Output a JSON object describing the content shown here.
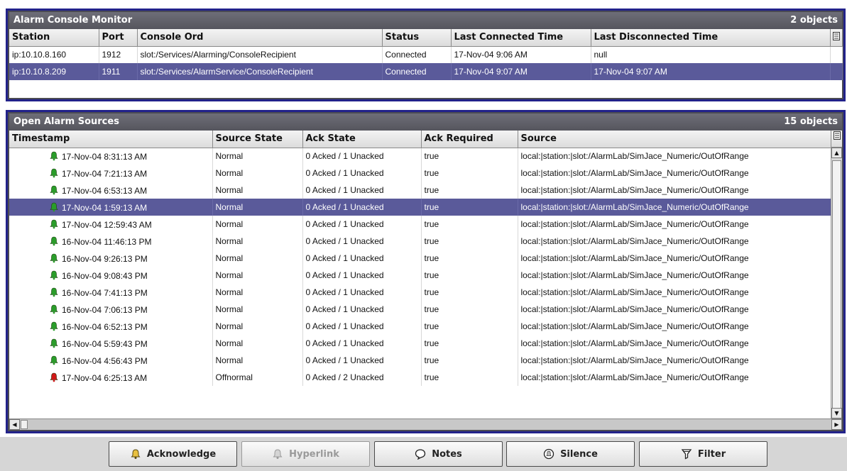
{
  "console_monitor": {
    "title": "Alarm Console Monitor",
    "count": "2 objects",
    "columns": [
      "Station",
      "Port",
      "Console Ord",
      "Status",
      "Last Connected Time",
      "Last Disconnected Time"
    ],
    "rows": [
      {
        "station": "ip:10.10.8.160",
        "port": "1912",
        "ord": "slot:/Services/Alarming/ConsoleRecipient",
        "status": "Connected",
        "last_connected": "17-Nov-04 9:06 AM",
        "last_disconnected": "null"
      },
      {
        "station": "ip:10.10.8.209",
        "port": "1911",
        "ord": "slot:/Services/AlarmService/ConsoleRecipient",
        "status": "Connected",
        "last_connected": "17-Nov-04 9:07 AM",
        "last_disconnected": "17-Nov-04 9:07 AM"
      }
    ]
  },
  "alarm_sources": {
    "title": "Open Alarm Sources",
    "count": "15 objects",
    "columns": [
      "Timestamp",
      "Source State",
      "Ack State",
      "Ack Required",
      "Source"
    ],
    "rows": [
      {
        "timestamp": "17-Nov-04 8:31:13 AM",
        "state": "Normal",
        "ack": "0 Acked / 1 Unacked",
        "req": "true",
        "source": "local:|station:|slot:/AlarmLab/SimJace_Numeric/OutOfRange",
        "bell": "green"
      },
      {
        "timestamp": "17-Nov-04 7:21:13 AM",
        "state": "Normal",
        "ack": "0 Acked / 1 Unacked",
        "req": "true",
        "source": "local:|station:|slot:/AlarmLab/SimJace_Numeric/OutOfRange",
        "bell": "green"
      },
      {
        "timestamp": "17-Nov-04 6:53:13 AM",
        "state": "Normal",
        "ack": "0 Acked / 1 Unacked",
        "req": "true",
        "source": "local:|station:|slot:/AlarmLab/SimJace_Numeric/OutOfRange",
        "bell": "green"
      },
      {
        "timestamp": "17-Nov-04 1:59:13 AM",
        "state": "Normal",
        "ack": "0 Acked / 1 Unacked",
        "req": "true",
        "source": "local:|station:|slot:/AlarmLab/SimJace_Numeric/OutOfRange",
        "bell": "green"
      },
      {
        "timestamp": "17-Nov-04 12:59:43 AM",
        "state": "Normal",
        "ack": "0 Acked / 1 Unacked",
        "req": "true",
        "source": "local:|station:|slot:/AlarmLab/SimJace_Numeric/OutOfRange",
        "bell": "green"
      },
      {
        "timestamp": "16-Nov-04 11:46:13 PM",
        "state": "Normal",
        "ack": "0 Acked / 1 Unacked",
        "req": "true",
        "source": "local:|station:|slot:/AlarmLab/SimJace_Numeric/OutOfRange",
        "bell": "green"
      },
      {
        "timestamp": "16-Nov-04 9:26:13 PM",
        "state": "Normal",
        "ack": "0 Acked / 1 Unacked",
        "req": "true",
        "source": "local:|station:|slot:/AlarmLab/SimJace_Numeric/OutOfRange",
        "bell": "green"
      },
      {
        "timestamp": "16-Nov-04 9:08:43 PM",
        "state": "Normal",
        "ack": "0 Acked / 1 Unacked",
        "req": "true",
        "source": "local:|station:|slot:/AlarmLab/SimJace_Numeric/OutOfRange",
        "bell": "green"
      },
      {
        "timestamp": "16-Nov-04 7:41:13 PM",
        "state": "Normal",
        "ack": "0 Acked / 1 Unacked",
        "req": "true",
        "source": "local:|station:|slot:/AlarmLab/SimJace_Numeric/OutOfRange",
        "bell": "green"
      },
      {
        "timestamp": "16-Nov-04 7:06:13 PM",
        "state": "Normal",
        "ack": "0 Acked / 1 Unacked",
        "req": "true",
        "source": "local:|station:|slot:/AlarmLab/SimJace_Numeric/OutOfRange",
        "bell": "green"
      },
      {
        "timestamp": "16-Nov-04 6:52:13 PM",
        "state": "Normal",
        "ack": "0 Acked / 1 Unacked",
        "req": "true",
        "source": "local:|station:|slot:/AlarmLab/SimJace_Numeric/OutOfRange",
        "bell": "green"
      },
      {
        "timestamp": "16-Nov-04 5:59:43 PM",
        "state": "Normal",
        "ack": "0 Acked / 1 Unacked",
        "req": "true",
        "source": "local:|station:|slot:/AlarmLab/SimJace_Numeric/OutOfRange",
        "bell": "green"
      },
      {
        "timestamp": "16-Nov-04 4:56:43 PM",
        "state": "Normal",
        "ack": "0 Acked / 1 Unacked",
        "req": "true",
        "source": "local:|station:|slot:/AlarmLab/SimJace_Numeric/OutOfRange",
        "bell": "green"
      },
      {
        "timestamp": "17-Nov-04 6:25:13 AM",
        "state": "Offnormal",
        "ack": "0 Acked / 2 Unacked",
        "req": "true",
        "source": "local:|station:|slot:/AlarmLab/SimJace_Numeric/OutOfRange",
        "bell": "red"
      }
    ]
  },
  "buttons": {
    "acknowledge": "Acknowledge",
    "hyperlink": "Hyperlink",
    "notes": "Notes",
    "silence": "Silence",
    "filter": "Filter"
  },
  "colors": {
    "bell_green": "#2a9d2a",
    "bell_red": "#d01818",
    "selection": "#5a5a9a",
    "panel_border": "#22228a"
  }
}
